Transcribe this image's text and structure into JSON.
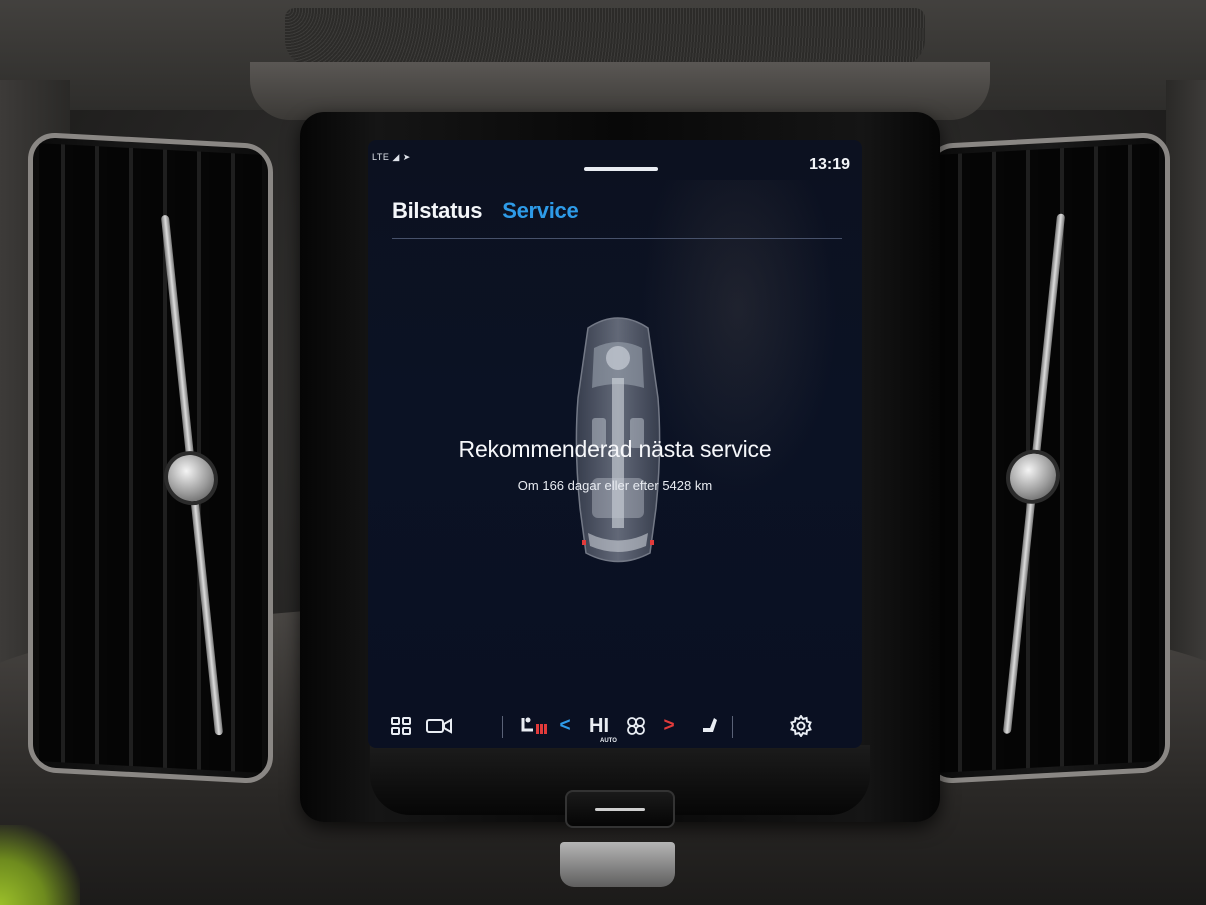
{
  "status_bar": {
    "signal_text": "LTE",
    "signal_icon": "signal-bars-icon",
    "location_icon": "location-arrow-icon",
    "time": "13:19"
  },
  "tabs": [
    {
      "label": "Bilstatus",
      "active": false
    },
    {
      "label": "Service",
      "active": true,
      "color": "#2e9be8"
    }
  ],
  "service": {
    "title": "Rekommenderad nästa service",
    "detail": "Om 166 dagar eller efter 5428 km",
    "illustration": "car-xray-top-view"
  },
  "bottom_bar": {
    "apps_icon": "app-grid-icon",
    "camera_icon": "camera-icon",
    "seat_heat_icon": "driver-seat-heat-icon",
    "temp_down": "<",
    "temperature": "HI",
    "temperature_mode": "AUTO",
    "fan_icon": "fan-icon",
    "temp_up": ">",
    "passenger_seat_icon": "passenger-seat-icon",
    "settings_icon": "gear-icon"
  },
  "colors": {
    "accent": "#2e9be8",
    "temp_up_arrow": "#e23b3b",
    "temp_down_arrow": "#2e9be8",
    "seat_heat": "#e23b3b"
  }
}
